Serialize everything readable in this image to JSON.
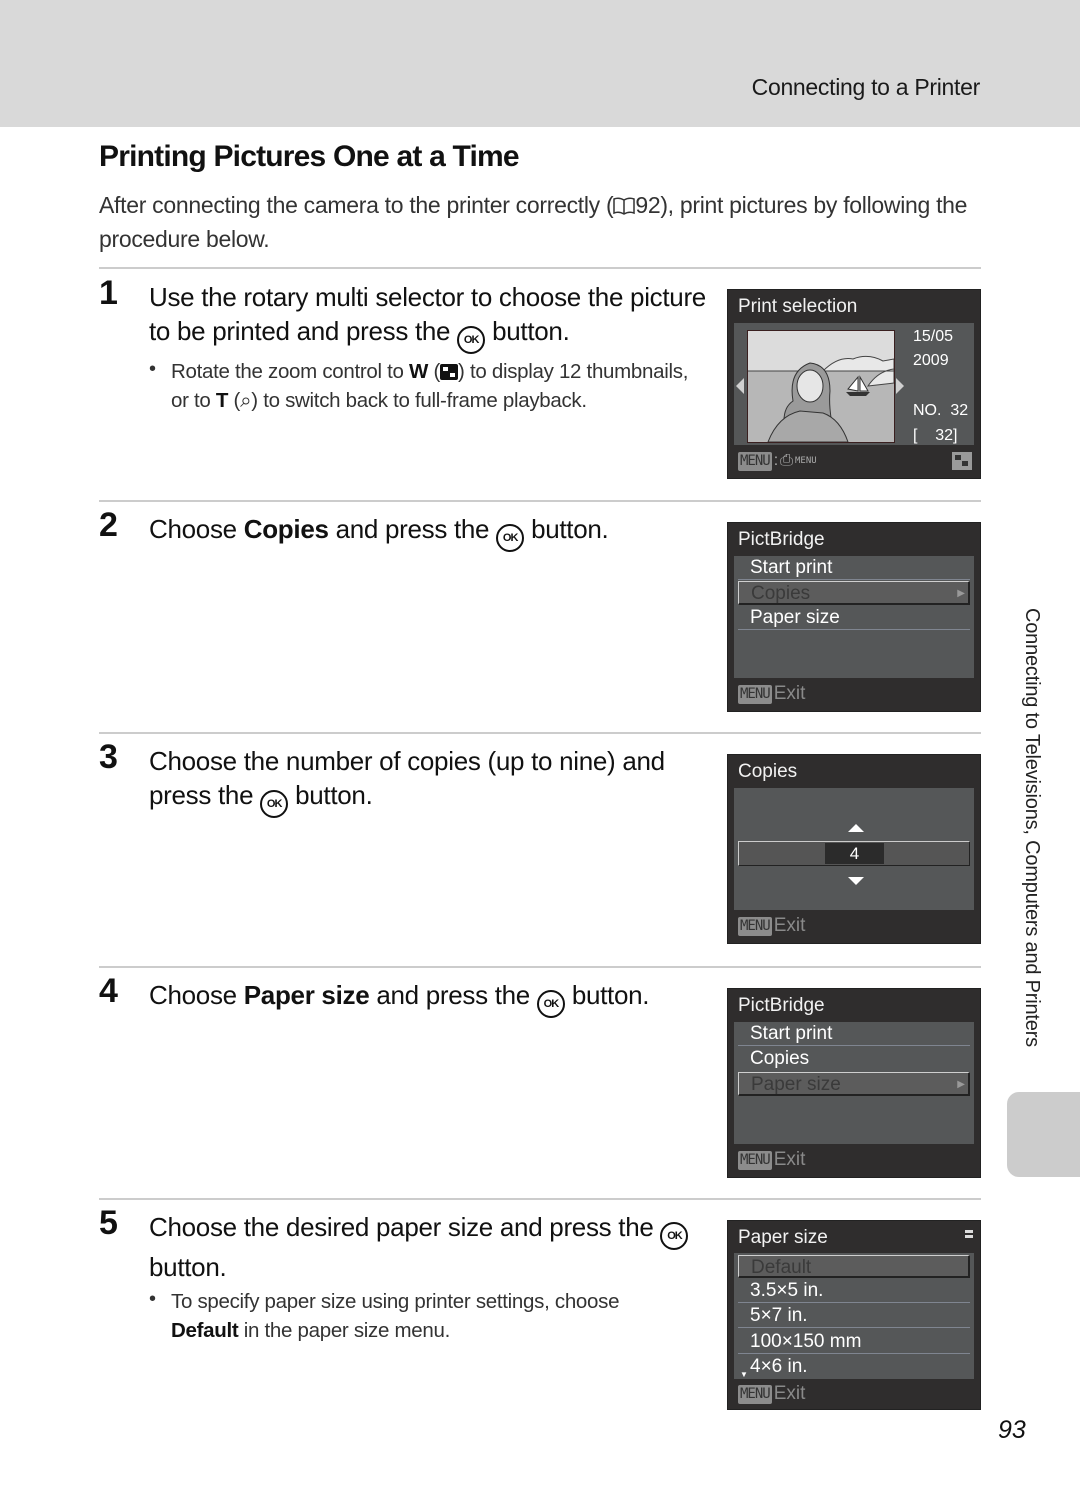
{
  "header": {
    "section_title": "Connecting to a Printer"
  },
  "page": {
    "title": "Printing Pictures One at a Time",
    "intro_before_ref": "After connecting the camera to the printer correctly (",
    "intro_ref": "92",
    "intro_after_ref": "), print pictures by following the procedure below.",
    "page_number": "93",
    "side_label": "Connecting to Televisions, Computers and Printers"
  },
  "steps": [
    {
      "number": "1",
      "text_before": "Use the rotary multi selector to choose the picture to be printed and press the ",
      "text_after": " button.",
      "bullet": {
        "part1": "Rotate the zoom control to ",
        "w": "W",
        "part2": " (",
        "part3": ") to display 12 thumbnails, or to ",
        "t": "T",
        "part4": " (",
        "magnifier": "Q",
        "part5": ") to switch back to full-frame playback."
      }
    },
    {
      "number": "2",
      "text_before": "Choose ",
      "bold": "Copies",
      "text_after": " and press the ",
      "text_end": " button."
    },
    {
      "number": "3",
      "text_before": "Choose the number of copies (up to nine) and press the ",
      "text_after": " button."
    },
    {
      "number": "4",
      "text_before": "Choose ",
      "bold": "Paper size",
      "text_after": " and press the ",
      "text_end": " button."
    },
    {
      "number": "5",
      "text_before": "Choose the desired paper size and press the ",
      "text_after": " button.",
      "bullet": {
        "part1": "To specify paper size using printer settings, choose ",
        "bold": "Default",
        "part2": " in the paper size menu."
      }
    }
  ],
  "ok_label": "OK",
  "screens": {
    "print_selection": {
      "title": "Print selection",
      "date": "15/05",
      "year": "2009",
      "no_label": "NO.",
      "no_value": "32",
      "count": "[    32]",
      "menu_label": "MENU",
      "print_menu_label": "MENU"
    },
    "pictbridge_copies": {
      "title": "PictBridge",
      "items": [
        "Start print",
        "Copies",
        "Paper size"
      ],
      "selected": 1,
      "menu_label": "MENU",
      "exit_label": "Exit"
    },
    "copies": {
      "title": "Copies",
      "value": "4",
      "max": "9",
      "menu_label": "MENU",
      "exit_label": "Exit"
    },
    "pictbridge_paper": {
      "title": "PictBridge",
      "items": [
        "Start print",
        "Copies",
        "Paper size"
      ],
      "selected": 2,
      "menu_label": "MENU",
      "exit_label": "Exit"
    },
    "paper_size": {
      "title": "Paper size",
      "items": [
        "Default",
        "3.5×5 in.",
        "5×7 in.",
        "100×150 mm",
        "4×6 in."
      ],
      "selected": 0,
      "menu_label": "MENU",
      "exit_label": "Exit"
    }
  }
}
